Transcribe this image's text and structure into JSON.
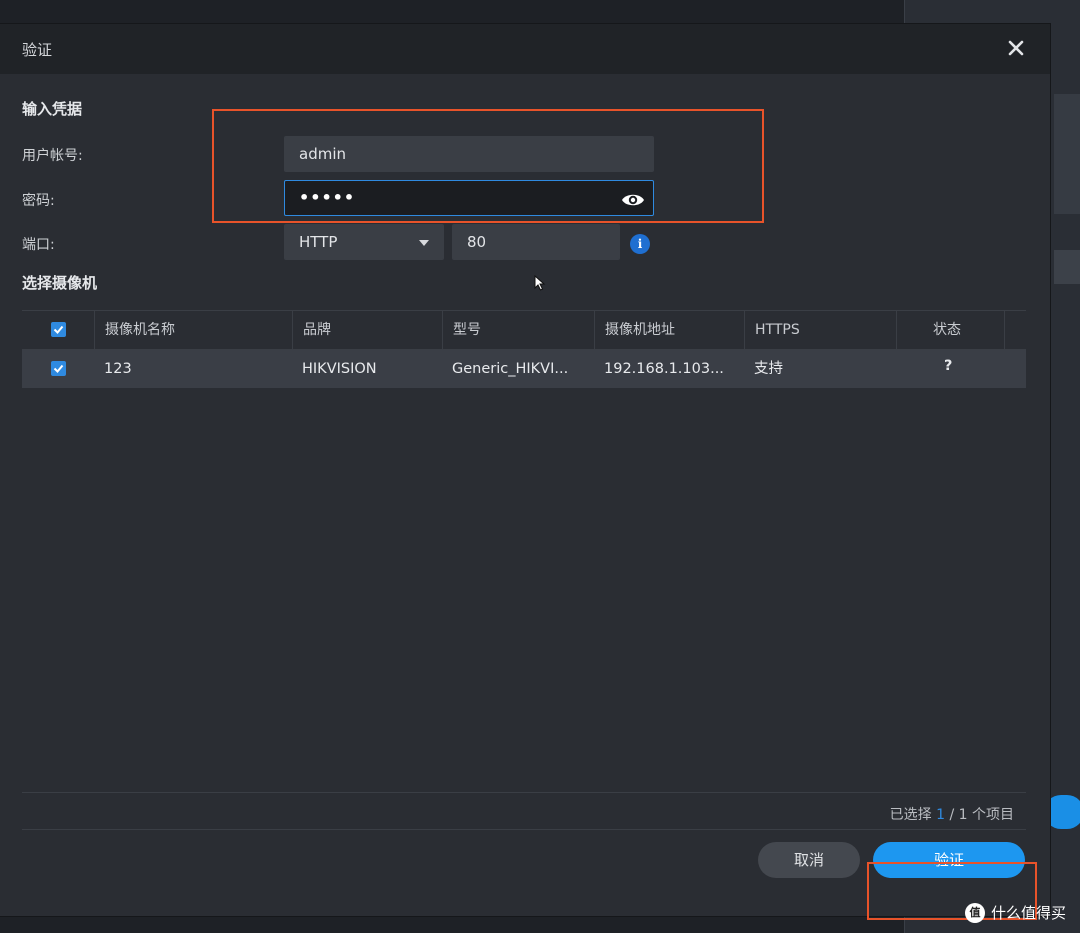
{
  "dialog": {
    "title": "验证",
    "close_icon": "close-icon"
  },
  "credentials": {
    "section_title": "输入凭据",
    "username_label": "用户帐号:",
    "username_value": "admin",
    "password_label": "密码:",
    "password_value": "•••••",
    "port_label": "端口:",
    "protocol_value": "HTTP",
    "port_value": "80"
  },
  "camera_section": {
    "section_title": "选择摄像机",
    "columns": [
      "摄像机名称",
      "品牌",
      "型号",
      "摄像机地址",
      "HTTPS",
      "状态"
    ],
    "rows": [
      {
        "checked": true,
        "name": "123",
        "brand": "HIKVISION",
        "model": "Generic_HIKVI...",
        "address": "192.168.1.103...",
        "https": "支持",
        "status": "?"
      }
    ]
  },
  "footer": {
    "selected_prefix": "已选择",
    "selected_count": "1",
    "selected_separator": "/",
    "selected_suffix": "1 个项目",
    "cancel_label": "取消",
    "verify_label": "验证"
  },
  "watermark": {
    "logo_text": "值",
    "text": "什么值得买"
  },
  "colors": {
    "accent": "#1d97f0",
    "highlight": "#e8532a",
    "dialog_bg": "#2a2d33"
  }
}
